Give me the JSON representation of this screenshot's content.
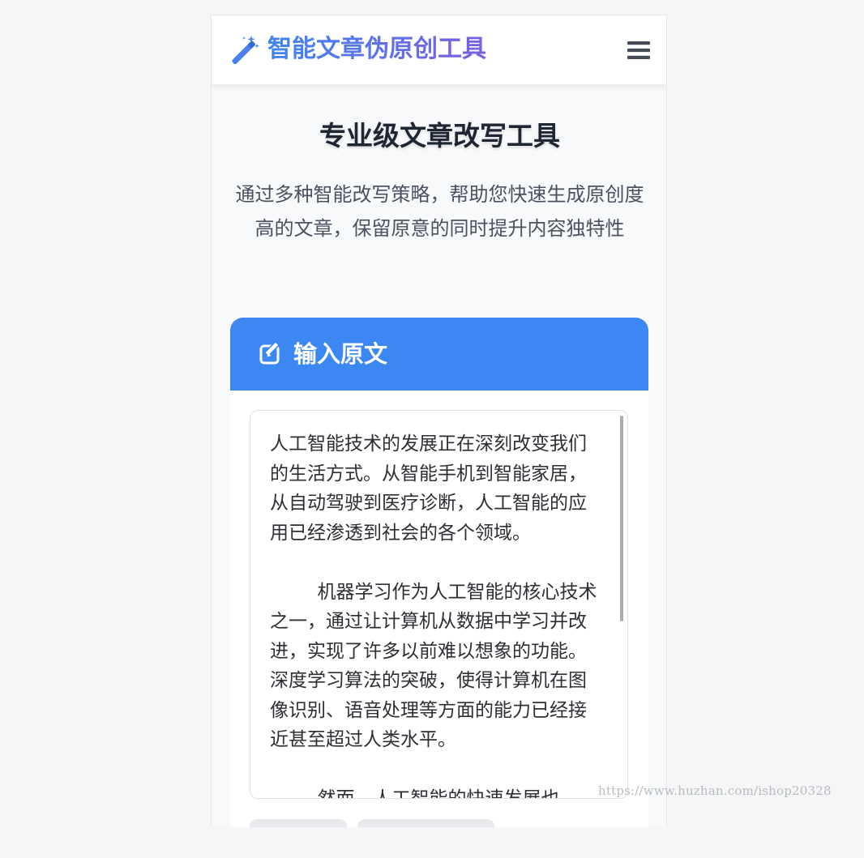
{
  "header": {
    "app_title": "智能文章伪原创工具",
    "logo_icon": "magic-wand-icon",
    "menu_icon": "hamburger-menu-icon"
  },
  "hero": {
    "title": "专业级文章改写工具",
    "subtitle": "通过多种智能改写策略，帮助您快速生成原创度高的文章，保留原意的同时提升内容独特性"
  },
  "input_card": {
    "header_icon": "edit-icon",
    "title": "输入原文",
    "text_value": "人工智能技术的发展正在深刻改变我们的生活方式。从智能手机到智能家居，从自动驾驶到医疗诊断，人工智能的应用已经渗透到社会的各个领域。\n\n        机器学习作为人工智能的核心技术之一，通过让计算机从数据中学习并改进，实现了许多以前难以想象的功能。深度学习算法的突破，使得计算机在图像识别、语音处理等方面的能力已经接近甚至超过人类水平。\n\n        然而，人工智能的快速发展也"
  },
  "watermark": "https://www.huzhan.com/ishop20328",
  "colors": {
    "brand_blue": "#3d87f3",
    "title_gradient_start": "#3f86ef",
    "title_gradient_end": "#7a5fe0",
    "page_background": "#f7f9fa"
  }
}
